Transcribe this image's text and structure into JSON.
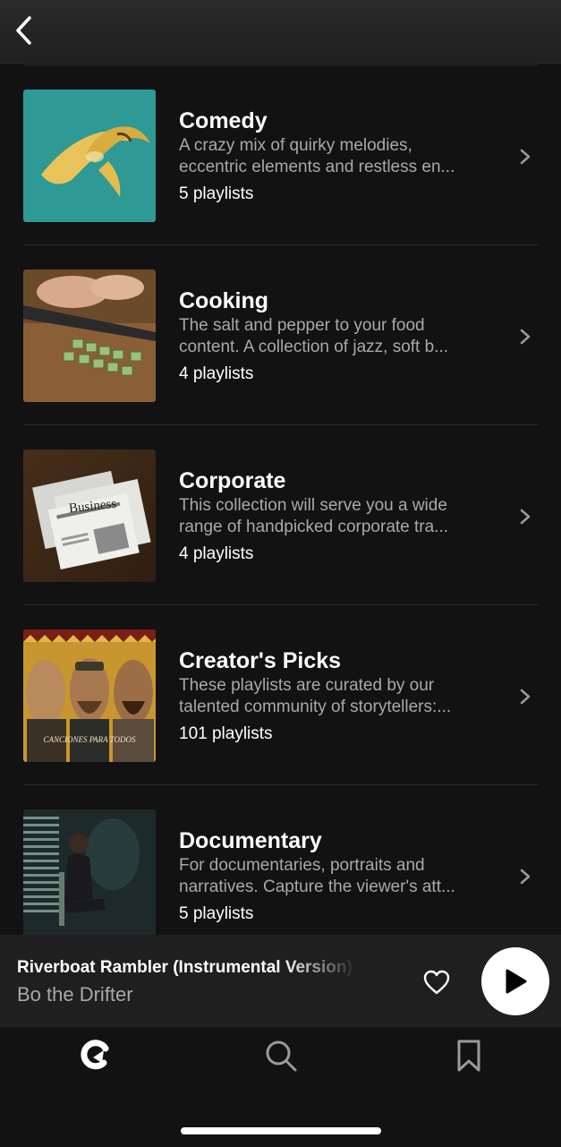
{
  "header": {
    "back_icon": "chevron-left-icon"
  },
  "categories": [
    {
      "title": "Comedy",
      "desc_line1": "A crazy mix of quirky melodies,",
      "desc_line2": "eccentric elements and restless en...",
      "count": "5 playlists",
      "thumb": "banana-peel"
    },
    {
      "title": "Cooking",
      "desc_line1": "The salt and pepper to your food",
      "desc_line2": "content. A collection of jazz, soft b...",
      "count": "4 playlists",
      "thumb": "chopping-board"
    },
    {
      "title": "Corporate",
      "desc_line1": "This collection will serve you a wide",
      "desc_line2": "range of handpicked corporate tra...",
      "count": "4 playlists",
      "thumb": "newspapers",
      "thumb_text": "Business"
    },
    {
      "title": "Creator's Picks",
      "desc_line1": "These playlists are curated by our",
      "desc_line2": "talented community of storytellers:...",
      "count": "101 playlists",
      "thumb": "three-men-poster",
      "thumb_text": "CANCIONES PARA TODOS"
    },
    {
      "title": "Documentary",
      "desc_line1": "For documentaries, portraits and",
      "desc_line2": "narratives. Capture the viewer's att...",
      "count": "5 playlists",
      "thumb": "woman-by-window"
    }
  ],
  "player": {
    "track": "Riverboat Rambler (Instrumental Version)",
    "artist": "Bo the Drifter",
    "heart_icon": "heart-icon",
    "play_icon": "play-icon"
  },
  "tabs": [
    "home-icon",
    "search-icon",
    "bookmark-icon"
  ],
  "colors": {
    "background": "#121212",
    "player": "#1f1f1f",
    "muted": "#a9a9a9"
  }
}
